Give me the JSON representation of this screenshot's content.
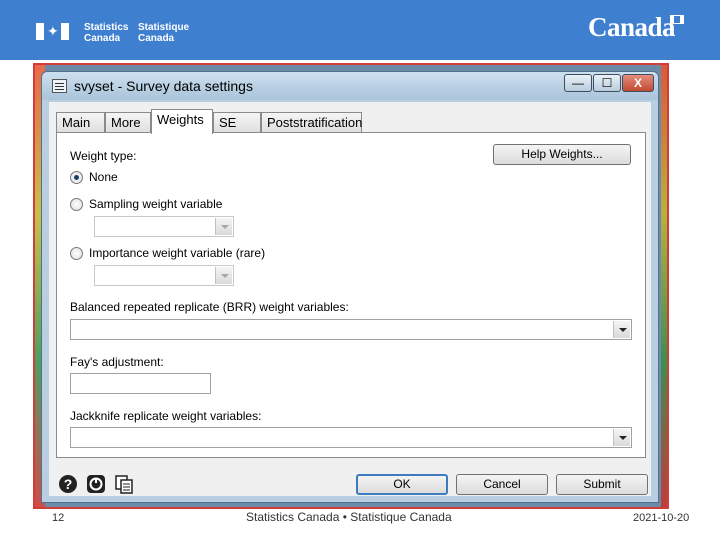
{
  "banner": {
    "org_en_line1": "Statistics",
    "org_en_line2": "Canada",
    "org_fr_line1": "Statistique",
    "org_fr_line2": "Canada",
    "wordmark": "Canada",
    "colors": {
      "banner": "#3f7fd0",
      "frame": "#d43c3c"
    }
  },
  "window": {
    "title": "svyset - Survey data settings",
    "minimize_glyph": "—",
    "maximize_glyph": "☐",
    "close_glyph": "X"
  },
  "tabs": [
    {
      "label": "Main",
      "active": false
    },
    {
      "label": "More",
      "active": false
    },
    {
      "label": "Weights",
      "active": true
    },
    {
      "label": "SE",
      "active": false
    },
    {
      "label": "Poststratification",
      "active": false
    }
  ],
  "weights": {
    "weight_type_label": "Weight type:",
    "help_button": "Help Weights...",
    "options": [
      {
        "label": "None",
        "selected": true
      },
      {
        "label": "Sampling weight variable",
        "selected": false
      },
      {
        "label": "Importance weight variable (rare)",
        "selected": false
      }
    ],
    "brr_label": "Balanced repeated replicate (BRR) weight variables:",
    "fay_label": "Fay's adjustment:",
    "jackknife_label": "Jackknife replicate weight variables:"
  },
  "buttons": {
    "ok": "OK",
    "cancel": "Cancel",
    "submit": "Submit"
  },
  "footer_icons": [
    "help-icon",
    "reset-icon",
    "copy-icon"
  ],
  "footer": {
    "page_number": "12",
    "center_text": "Statistics Canada • Statistique Canada",
    "date": "2021-10-20"
  }
}
